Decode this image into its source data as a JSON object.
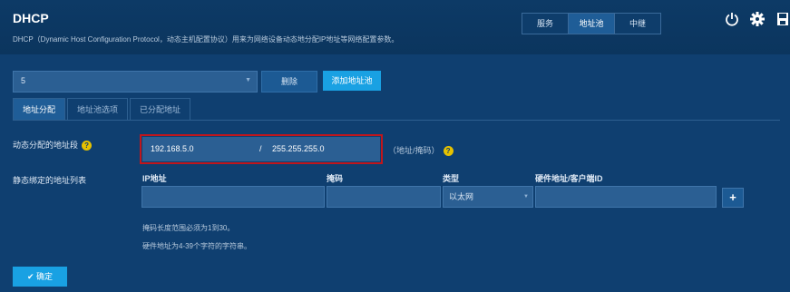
{
  "header": {
    "title": "DHCP",
    "subtitle": "DHCP（Dynamic Host Configuration Protocol，动态主机配置协议）用来为网络设备动态地分配IP地址等网络配置参数。",
    "tabs": [
      {
        "label": "服务",
        "active": false
      },
      {
        "label": "地址池",
        "active": true
      },
      {
        "label": "中继",
        "active": false
      }
    ],
    "icons": [
      "power-icon",
      "gear-icon",
      "save-icon"
    ]
  },
  "pool": {
    "selected": "5",
    "delete_label": "删除",
    "add_label": "添加地址池"
  },
  "subtabs": [
    {
      "label": "地址分配",
      "active": true
    },
    {
      "label": "地址池选项",
      "active": false
    },
    {
      "label": "已分配地址",
      "active": false
    }
  ],
  "dynamic": {
    "label": "动态分配的地址段",
    "ip": "192.168.5.0",
    "separator": "/",
    "mask": "255.255.255.0",
    "hint": "（地址/掩码）"
  },
  "static": {
    "label": "静态绑定的地址列表",
    "columns": [
      "IP地址",
      "掩码",
      "类型",
      "硬件地址/客户端ID"
    ],
    "row": {
      "ip": "",
      "mask": "",
      "type": "以太网",
      "hw": ""
    },
    "add_label": "+"
  },
  "notes": [
    "掩码长度范围必须为1到30。",
    "硬件地址为4-39个字符的字符串。"
  ],
  "confirm_label": "✔ 确定",
  "colors": {
    "background": "#0f3f70",
    "accent": "#19a1e3",
    "highlight_border": "#c0161c",
    "help": "#e6c200"
  }
}
